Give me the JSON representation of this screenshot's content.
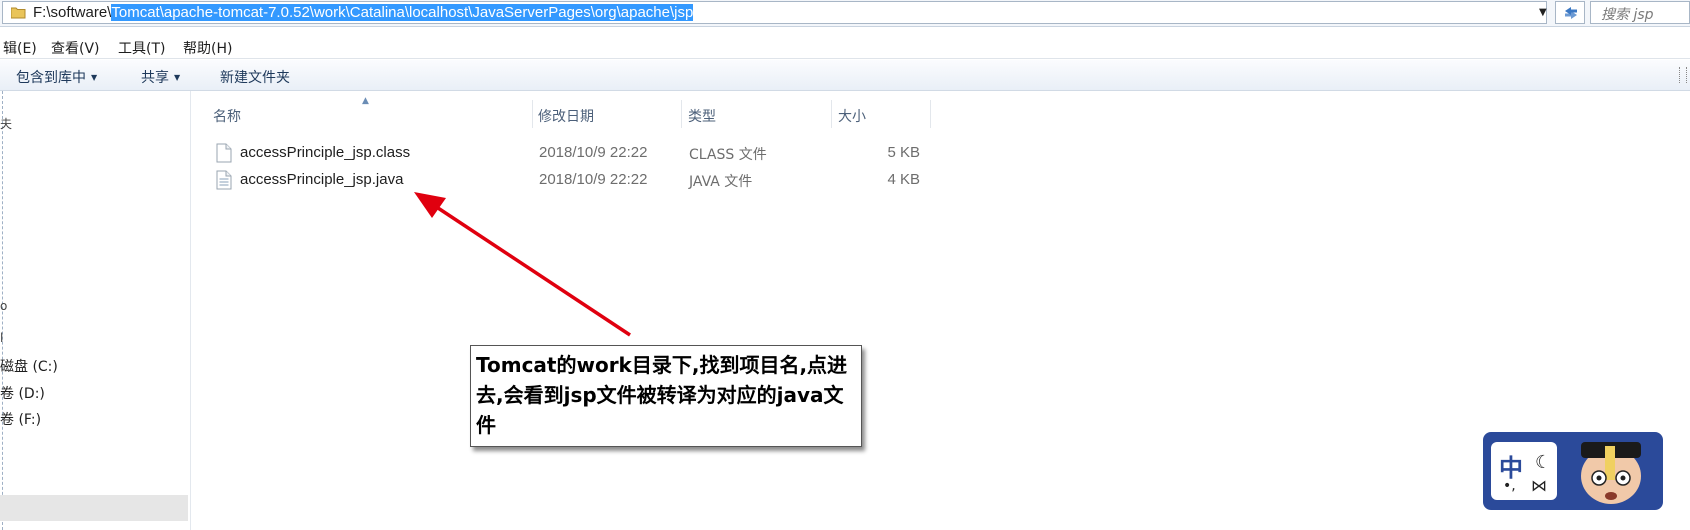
{
  "address": {
    "prefix": "F:\\software\\",
    "selected": "Tomcat\\apache-tomcat-7.0.52\\work\\Catalina\\localhost\\JavaServerPages\\org\\apache\\jsp",
    "search_placeholder": "搜索 jsp"
  },
  "menu": [
    {
      "label": "辑(E)"
    },
    {
      "label": "查看(V)"
    },
    {
      "label": "工具(T)"
    },
    {
      "label": "帮助(H)"
    }
  ],
  "toolbar": {
    "include_library": "包含到库中",
    "share": "共享",
    "new_folder": "新建文件夹"
  },
  "nav": {
    "glyphs": [
      "夫",
      "o",
      "l"
    ],
    "items": [
      {
        "label": "磁盘 (C:)"
      },
      {
        "label": "卷 (D:)"
      },
      {
        "label": "卷 (F:)"
      }
    ]
  },
  "columns": {
    "name": "名称",
    "date": "修改日期",
    "type": "类型",
    "size": "大小"
  },
  "files": [
    {
      "name": "accessPrinciple_jsp.class",
      "date": "2018/10/9 22:22",
      "type": "CLASS 文件",
      "size": "5 KB",
      "icon": "blank-file-icon"
    },
    {
      "name": "accessPrinciple_jsp.java",
      "date": "2018/10/9 22:22",
      "type": "JAVA 文件",
      "size": "4 KB",
      "icon": "text-file-icon"
    }
  ],
  "annotation": {
    "text": "Tomcat的work目录下,找到项目名,点进去,会看到jsp文件被转译为对应的java文件",
    "arrow_color": "#e0000f"
  },
  "ime": {
    "label": "中",
    "brand_color": "#2b4a9a"
  },
  "colors": {
    "selection": "#3399ff",
    "toolbar_text": "#1e395b",
    "header_text": "#4c607a"
  }
}
